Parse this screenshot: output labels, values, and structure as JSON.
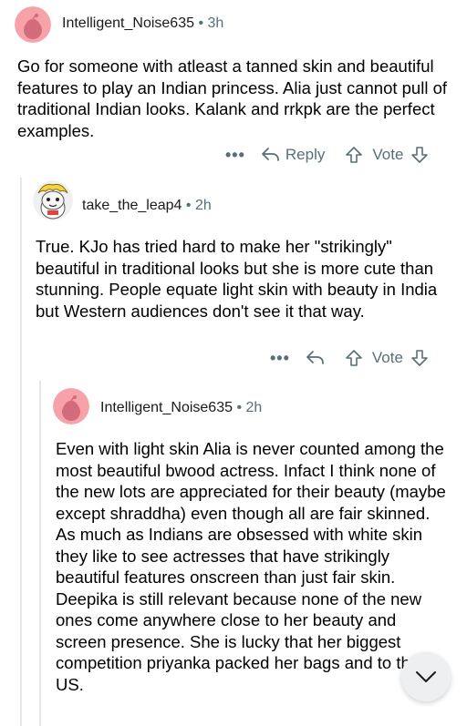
{
  "comments": [
    {
      "author": "Intelligent_Noise635",
      "time": "3h",
      "body": "Go for someone with atleast a tanned skin and beautiful features to play an Indian princess. Alia just cannot pull of traditional Indian looks. Kalank and rrkpk are the perfect examples.",
      "reply_label": "Reply",
      "vote_label": "Vote"
    },
    {
      "author": "take_the_leap4",
      "time": "2h",
      "body": "True. KJo has tried hard to make her \"strikingly\" beautiful in traditional looks but she is more cute than stunning. People equate light skin with beauty in India but Western audiences don't see it that way.",
      "vote_label": "Vote"
    },
    {
      "author": "Intelligent_Noise635",
      "time": "2h",
      "body": "Even with light skin Alia is never counted among the most beautiful bwood actress. Infact I think none of the new lots are appreciated for their beauty (maybe except shraddha) even though all are fair skinned. As much as Indians are obsessed with white skin they like to see actresses that have strikingly beautiful features onscreen than just fair skin. Deepika is still relevant because none of the new ones come anywhere close to her beauty and screen presence. She is lucky that her biggest competition priyanka packed her bags and to the US."
    }
  ],
  "separator": "•",
  "more_label": "•••",
  "colors": {
    "avatar_pink": "#f7a1a9",
    "meta_gray": "#576f76",
    "fab_bg": "#edeff1"
  },
  "icons": [
    "snoo-avatar-icon",
    "cartoon-avatar-icon",
    "reply-arrow-icon",
    "upvote-icon",
    "downvote-icon",
    "chevron-down-icon",
    "more-icon"
  ]
}
